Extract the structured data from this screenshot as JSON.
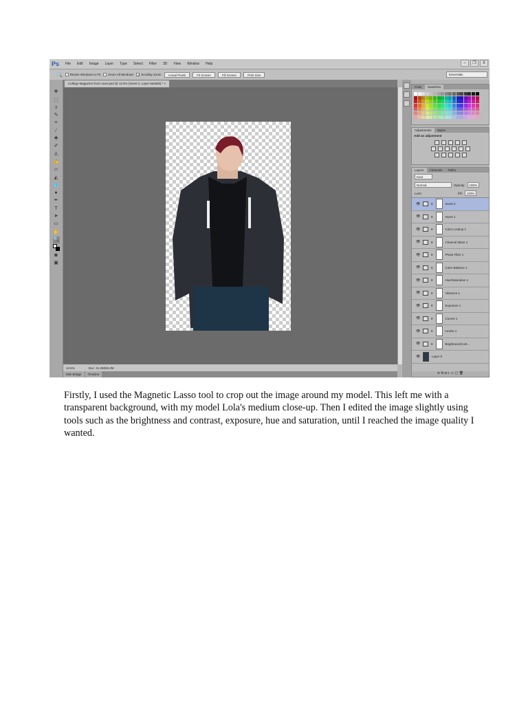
{
  "app": {
    "logo": "Ps",
    "menu": [
      "File",
      "Edit",
      "Image",
      "Layer",
      "Type",
      "Select",
      "Filter",
      "3D",
      "View",
      "Window",
      "Help"
    ],
    "window_buttons": [
      "–",
      "❐",
      "X"
    ],
    "options": {
      "resize": "Resize Windows to Fit",
      "zoom_all": "Zoom All Windows",
      "scrubby": "Scrubby Zoom",
      "actual": "Actual Pixels",
      "fit": "Fit Screen",
      "fill": "Fill Screen",
      "print": "Print Size",
      "workspace": "Essentials"
    },
    "doc_tab": "College Magazine front cover.psd @ 12.5% (Invert 2, Layer Mask/8) *  ×",
    "status": {
      "zoom": "12.5%",
      "doc": "Doc: 41.2M/26.2M"
    },
    "bottom_tabs": [
      "Mini Bridge",
      "Timeline"
    ],
    "color_tabs": [
      "Color",
      "Swatches"
    ],
    "adj_tabs": [
      "Adjustments",
      "Styles"
    ],
    "adj_title": "Add an adjustment",
    "layer_tabs": [
      "Layers",
      "Channels",
      "Paths"
    ],
    "kind": "Kind",
    "blend": "Normal",
    "opacity_label": "Opacity:",
    "opacity": "100%",
    "lock_label": "Lock:",
    "fill_label": "Fill:",
    "fill": "100%",
    "layers": [
      "Invert 2",
      "Invert 1",
      "Color Lookup 1",
      "Channel Mixer 1",
      "Photo Filter 1",
      "Color Balance 1",
      "Hue/Saturation 1",
      "Vibrance 1",
      "Exposure 1",
      "Curves 1",
      "Levels 1",
      "Brightness/Cont...",
      "Layer 0"
    ],
    "selected_layer": "Invert 2"
  },
  "caption": "Firstly, I used the Magnetic Lasso tool to crop out the image around my model. This left me with a transparent background, with my model Lola's medium close-up. Then I edited the image slightly using tools such as the brightness and contrast, exposure, hue and saturation, until I reached the image quality I wanted."
}
